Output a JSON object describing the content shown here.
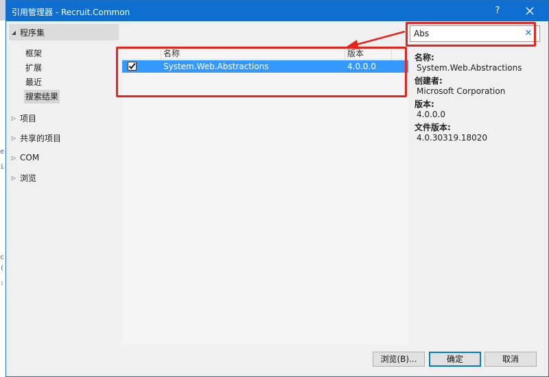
{
  "window": {
    "title": "引用管理器 - Recruit.Common",
    "help": "?",
    "close": "✕"
  },
  "left_pane": {
    "assemblies": "程序集",
    "sub_items": [
      "框架",
      "扩展",
      "最近",
      "搜索结果"
    ],
    "projects": "项目",
    "shared_projects": "共享的项目",
    "com": "COM",
    "browse": "浏览"
  },
  "list": {
    "columns": {
      "name": "名称",
      "version": "版本"
    },
    "rows": [
      {
        "name": "System.Web.Abstractions",
        "version": "4.0.0.0",
        "checked": true
      }
    ]
  },
  "search": {
    "value": "Abs",
    "clear": "✕"
  },
  "details": {
    "name_label": "名称:",
    "name_value": "System.Web.Abstractions",
    "creator_label": "创建者:",
    "creator_value": "Microsoft Corporation",
    "version_label": "版本:",
    "version_value": "4.0.0.0",
    "file_version_label": "文件版本:",
    "file_version_value": "4.0.30319.18020"
  },
  "buttons": {
    "browse": "浏览(B)...",
    "ok": "确定",
    "cancel": "取消"
  },
  "colors": {
    "accent": "#0e6fd0",
    "selection": "#3399ff",
    "annotation": "#e8231b"
  }
}
